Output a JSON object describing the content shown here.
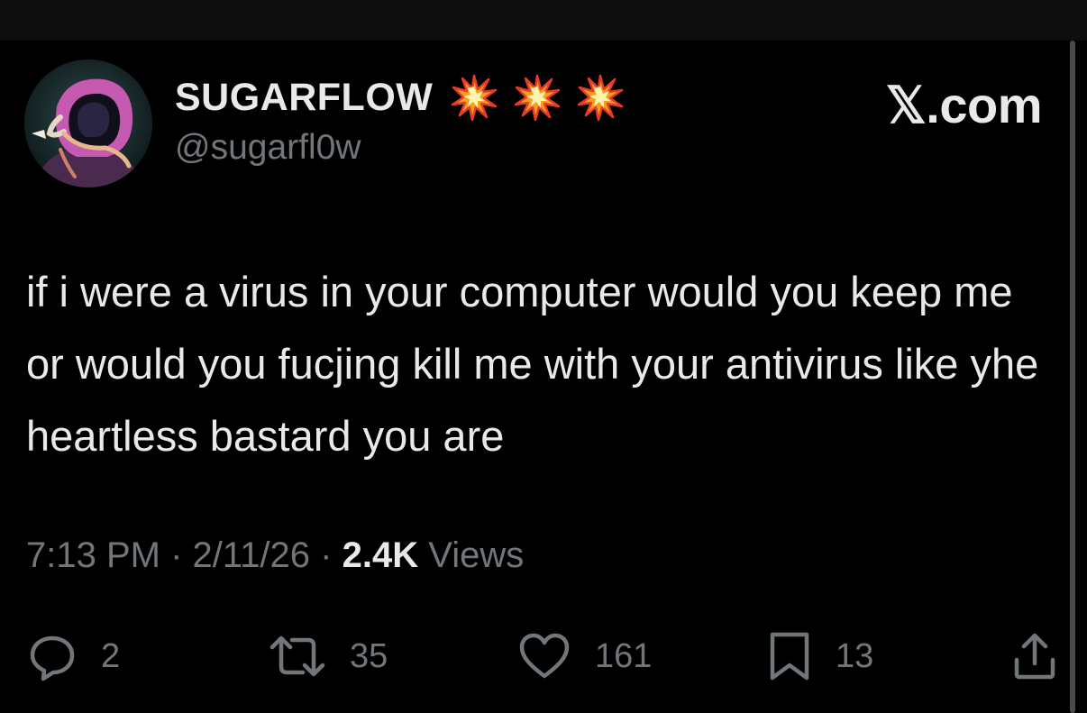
{
  "author": {
    "display_name": "SUGARFLOW",
    "handle": "@sugarfl0w",
    "badges": [
      "collision-emoji",
      "collision-emoji",
      "collision-emoji"
    ]
  },
  "brand": "𝕏.com",
  "tweet": {
    "text": "if i were a virus in your computer would you keep me or would you fucjing kill me with your antivirus like yhe heartless bastard you are"
  },
  "meta": {
    "time": "7:13 PM",
    "separator": "·",
    "date": "2/11/26",
    "views_count": "2.4K",
    "views_label": "Views"
  },
  "actions": {
    "replies": "2",
    "reposts": "35",
    "likes": "161",
    "bookmarks": "13"
  },
  "colors": {
    "background": "#000000",
    "text": "#e7e9ea",
    "muted": "#71767b"
  }
}
